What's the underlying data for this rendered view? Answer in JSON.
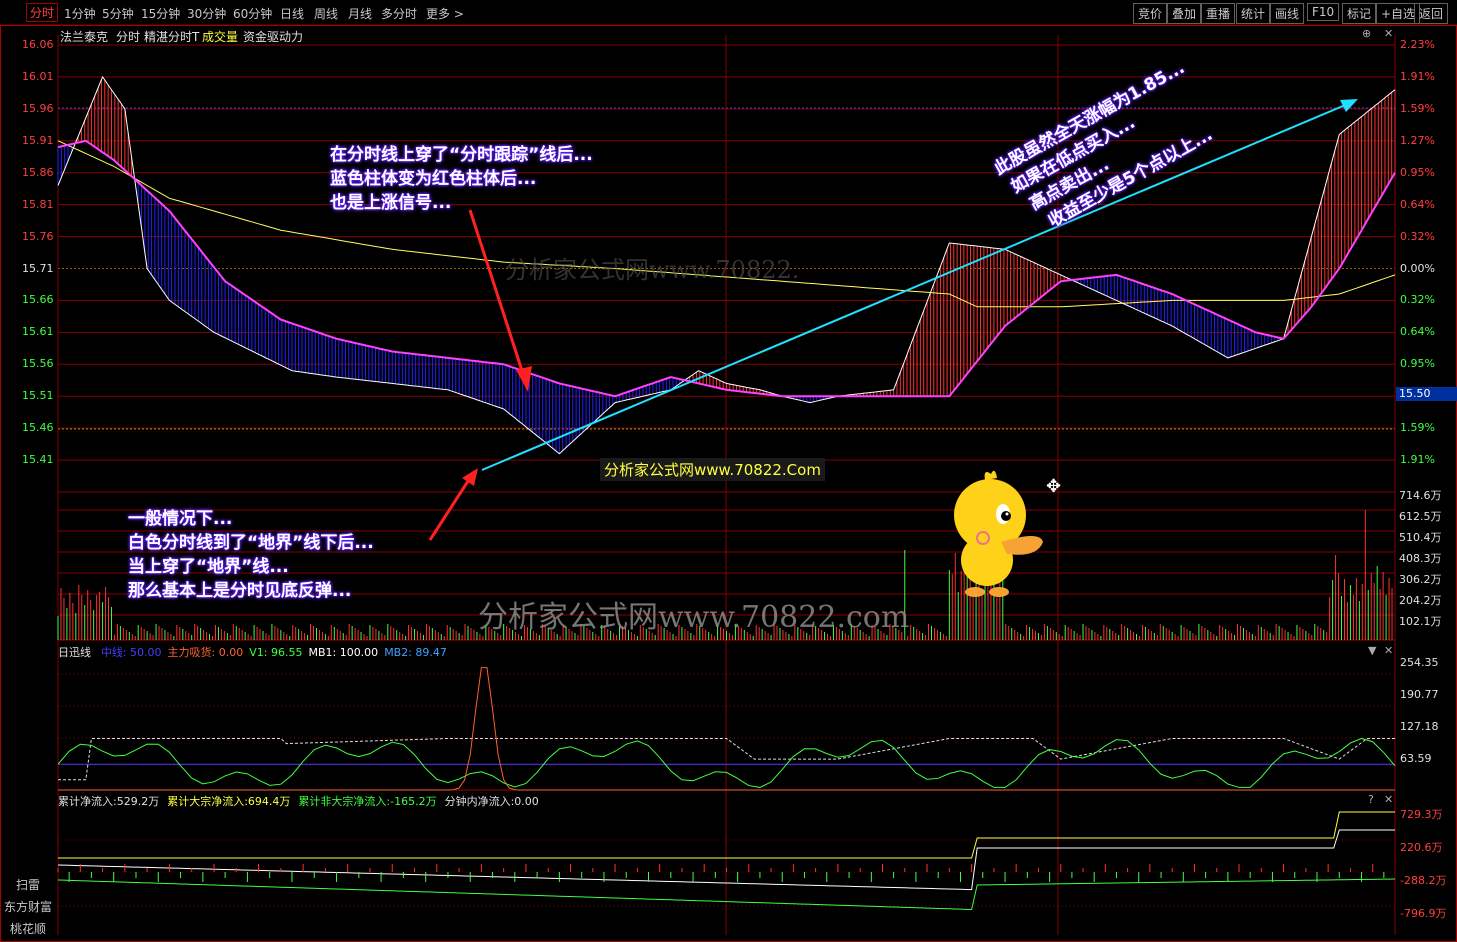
{
  "toolbar": {
    "tabs": [
      "分时",
      "1分钟",
      "5分钟",
      "15分钟",
      "30分钟",
      "60分钟",
      "日线",
      "周线",
      "月线",
      "多分时",
      "更多 >"
    ],
    "right_buttons": [
      "竞价",
      "叠加",
      "重播",
      "统计",
      "画线",
      "F10",
      "标记",
      "+自选",
      "返回"
    ]
  },
  "header": {
    "stock_name": "法兰泰克",
    "items": [
      "分时",
      "精湛分时T",
      "成交量",
      "资金驱动力"
    ]
  },
  "colors": {
    "up": "#ff3030",
    "down": "#2020ff",
    "grid": "#880000",
    "price_line": "#ffffff",
    "track_line": "#ff40ff",
    "avg_line": "#ffff60",
    "ref_line": "#4040ff"
  },
  "price_axis": {
    "left": [
      "16.06",
      "16.01",
      "15.96",
      "15.91",
      "15.86",
      "15.81",
      "15.76",
      "15.71",
      "15.66",
      "15.61",
      "15.56",
      "15.51",
      "15.46",
      "15.41"
    ],
    "right": [
      "2.23%",
      "1.91%",
      "1.59%",
      "1.27%",
      "0.95%",
      "0.64%",
      "0.32%",
      "0.00%",
      "0.32%",
      "0.64%",
      "0.95%",
      "1.27%",
      "1.59%",
      "1.91%"
    ],
    "current_price": "15.50"
  },
  "volume_axis": [
    "714.6万",
    "612.5万",
    "510.4万",
    "408.3万",
    "306.2万",
    "204.2万",
    "102.1万"
  ],
  "indicator1": {
    "name": "日迅线",
    "params": [
      {
        "label": "中线: 50.00",
        "color": "#4040ff"
      },
      {
        "label": "主力吸货: 0.00",
        "color": "#ff6030"
      },
      {
        "label": "V1: 96.55",
        "color": "#40ff40"
      },
      {
        "label": "MB1: 100.00",
        "color": "#ffffff"
      },
      {
        "label": "MB2: 89.47",
        "color": "#40a0ff"
      }
    ],
    "axis": [
      "254.35",
      "190.77",
      "127.18",
      "63.59"
    ]
  },
  "indicator2": {
    "params": [
      {
        "label": "累计净流入:529.2万",
        "color": "#e0e0e0"
      },
      {
        "label": "累计大宗净流入:694.4万",
        "color": "#ffff40"
      },
      {
        "label": "累计非大宗净流入:-165.2万",
        "color": "#40ff40"
      },
      {
        "label": "分钟内净流入:0.00",
        "color": "#e0e0e0"
      }
    ],
    "axis": [
      "729.3万",
      "220.6万",
      "-288.2万",
      "-796.9万"
    ]
  },
  "left_buttons": [
    "扫雷",
    "东方财富",
    "桃花顺"
  ],
  "annotations": {
    "a1": [
      "在分时线上穿了“分时跟踪”线后...",
      "蓝色柱体变为红色柱体后...",
      "也是上涨信号..."
    ],
    "a2": [
      "一般情况下...",
      "白色分时线到了“地界”线下后...",
      "当上穿了“地界”线...",
      "那么基本上是分时见底反弹..."
    ],
    "a3": [
      "此股虽然全天涨幅为1.85...",
      "如果在低点买入...",
      "高点卖出...",
      "收益至少是5个点以上..."
    ]
  },
  "watermarks": [
    "分析家公式网www.70822.com",
    "分析家公式网www.70822.Com",
    "分析家公式网www.70822."
  ],
  "chart_data": {
    "type": "line",
    "prev_close": 15.71,
    "ylim": [
      15.36,
      16.06
    ],
    "series": [
      {
        "name": "分时",
        "x": [
          0,
          8,
          12,
          16,
          20,
          28,
          35,
          42,
          50,
          60,
          70,
          80,
          90,
          100,
          110,
          115,
          120,
          126,
          130,
          135,
          140,
          150,
          160,
          170,
          180,
          190,
          200,
          210,
          220,
          230,
          240
        ],
        "values": [
          15.84,
          16.01,
          15.96,
          15.71,
          15.66,
          15.61,
          15.58,
          15.55,
          15.54,
          15.53,
          15.52,
          15.49,
          15.42,
          15.5,
          15.52,
          15.55,
          15.53,
          15.52,
          15.51,
          15.5,
          15.51,
          15.52,
          15.75,
          15.74,
          15.7,
          15.66,
          15.62,
          15.57,
          15.6,
          15.92,
          15.99
        ]
      },
      {
        "name": "分时跟踪",
        "x": [
          0,
          5,
          10,
          20,
          30,
          40,
          50,
          60,
          70,
          80,
          90,
          100,
          110,
          120,
          130,
          140,
          150,
          160,
          170,
          180,
          190,
          200,
          210,
          215,
          220,
          225,
          230,
          240
        ],
        "values": [
          15.9,
          15.91,
          15.88,
          15.8,
          15.69,
          15.63,
          15.6,
          15.58,
          15.57,
          15.56,
          15.53,
          15.51,
          15.54,
          15.52,
          15.51,
          15.51,
          15.51,
          15.51,
          15.62,
          15.69,
          15.7,
          15.67,
          15.63,
          15.61,
          15.6,
          15.65,
          15.71,
          15.86
        ]
      }
    ]
  }
}
